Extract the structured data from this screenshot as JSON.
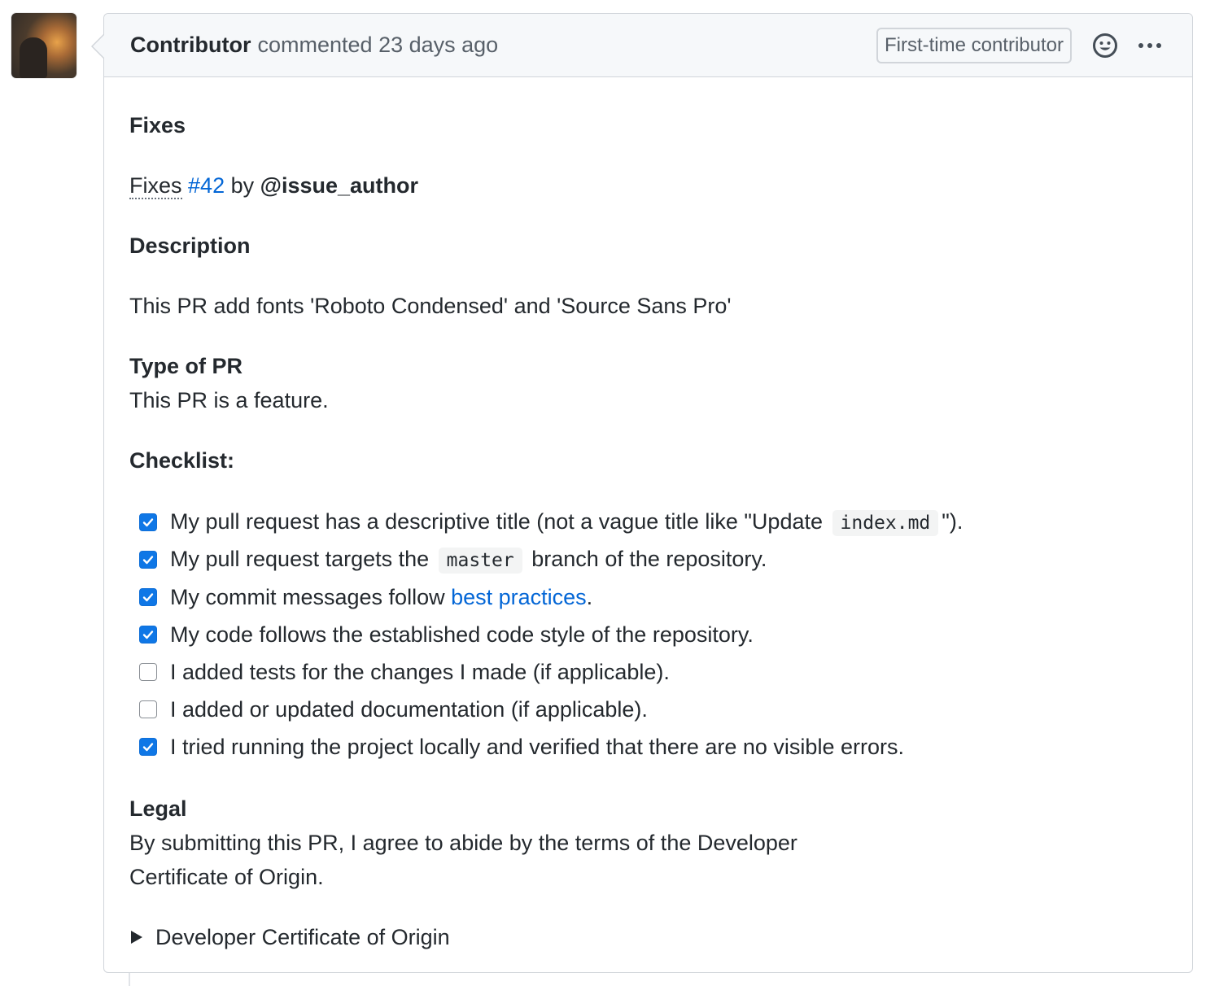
{
  "comment": {
    "author": "Contributor",
    "action": "commented",
    "time": "23 days ago",
    "badge": "First-time contributor"
  },
  "body": {
    "fixes_heading": "Fixes",
    "fixes_word": "Fixes",
    "issue_ref": "#42",
    "by_word": "by",
    "issue_author": "@issue_author",
    "description_heading": "Description",
    "description_text": "This PR add fonts 'Roboto Condensed' and 'Source Sans Pro'",
    "type_heading": "Type of PR",
    "type_text": "This PR is a feature.",
    "checklist_heading": "Checklist:",
    "checklist": [
      {
        "checked": true,
        "pre": "My pull request has a descriptive title (not a vague title like \"Update ",
        "code": "index.md",
        "link": "",
        "post": "\")."
      },
      {
        "checked": true,
        "pre": "My pull request targets the ",
        "code": "master",
        "link": "",
        "post": " branch of the repository."
      },
      {
        "checked": true,
        "pre": "My commit messages follow ",
        "code": "",
        "link": "best practices",
        "post": "."
      },
      {
        "checked": true,
        "pre": "My code follows the established code style of the repository.",
        "code": "",
        "link": "",
        "post": ""
      },
      {
        "checked": false,
        "pre": "I added tests for the changes I made (if applicable).",
        "code": "",
        "link": "",
        "post": ""
      },
      {
        "checked": false,
        "pre": "I added or updated documentation (if applicable).",
        "code": "",
        "link": "",
        "post": ""
      },
      {
        "checked": true,
        "pre": "I tried running the project locally and verified that there are no visible errors.",
        "code": "",
        "link": "",
        "post": ""
      }
    ],
    "legal_heading": "Legal",
    "legal_line1": "By submitting this PR, I agree to abide by the terms of the Developer",
    "legal_line2": "Certificate of Origin.",
    "details_summary": "Developer Certificate of Origin"
  },
  "colors": {
    "link": "#0366d6",
    "checkbox_checked": "#0f77e6",
    "header_bg": "#f6f8fa",
    "border": "#d1d5da"
  },
  "icons": {
    "emoji": "smiley-icon",
    "more": "kebab-horizontal-icon",
    "checkbox_checked": "checkmark-icon",
    "details": "triangle-right-icon"
  }
}
